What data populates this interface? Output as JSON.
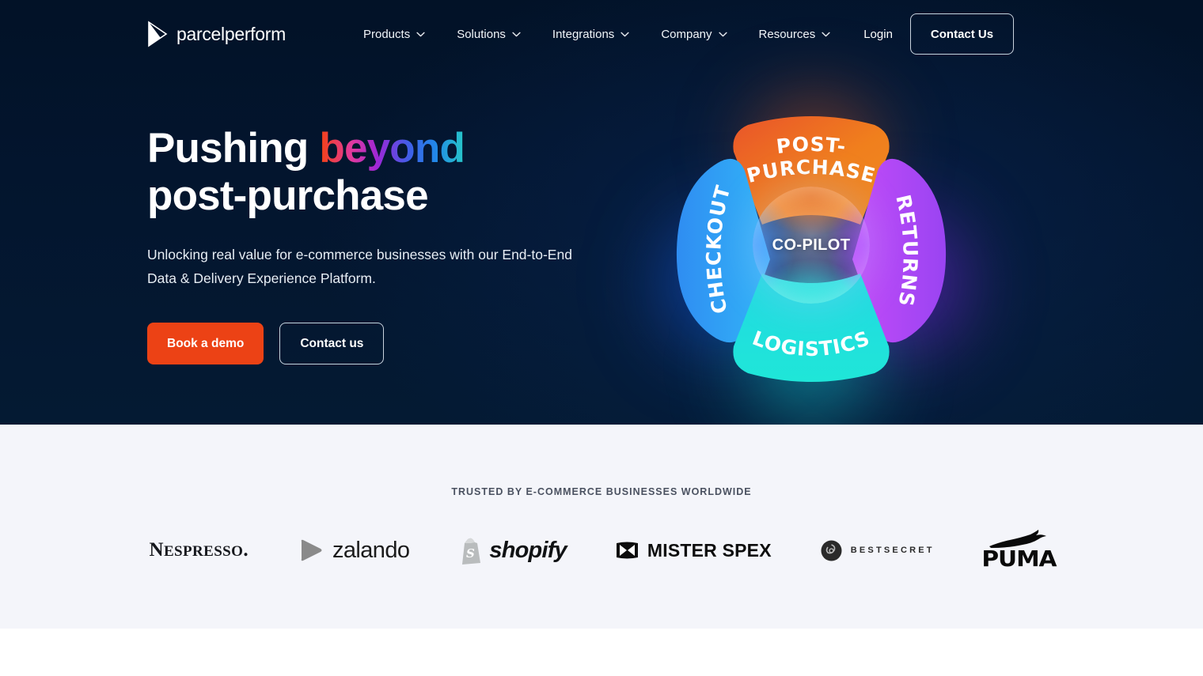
{
  "brand": {
    "logo_text": "parcelperform",
    "logo_icon": "triangle-play-mark",
    "accent_orange": "#ec4215",
    "hero_bg": "#03152e",
    "band_bg": "#f4f5fa"
  },
  "nav": {
    "items": [
      {
        "label": "Products",
        "has_chevron": true
      },
      {
        "label": "Solutions",
        "has_chevron": true
      },
      {
        "label": "Integrations",
        "has_chevron": true
      },
      {
        "label": "Company",
        "has_chevron": true
      },
      {
        "label": "Resources",
        "has_chevron": true
      }
    ],
    "login_label": "Login",
    "contact_label": "Contact Us"
  },
  "hero": {
    "headline_part1": "Pushing ",
    "headline_gradient_word": "beyond",
    "headline_part2": "post-purchase",
    "subcopy_line1": "Unlocking real value for e-commerce businesses with our",
    "subcopy_line2": "End-to-End Data & Delivery Experience Platform.",
    "cta_primary": "Book a demo",
    "cta_secondary": "Contact us",
    "gradient_stops": [
      "#f4410f",
      "#9d27d6",
      "#3f5fe8",
      "#27c8c8"
    ]
  },
  "graphic": {
    "center_label": "CO-PILOT",
    "petals": [
      {
        "name": "post-purchase",
        "line1": "POST-",
        "line2": "PURCHASE",
        "color": "#ee7a1f",
        "position": "top"
      },
      {
        "name": "checkout",
        "line1": "CHECKOUT",
        "line2": "",
        "color": "#2d9bf0",
        "position": "left"
      },
      {
        "name": "returns",
        "line1": "RETURNS",
        "line2": "",
        "color": "#b14cf5",
        "position": "right"
      },
      {
        "name": "logistics",
        "line1": "LOGISTICS",
        "line2": "",
        "color": "#24dede",
        "position": "bottom"
      }
    ]
  },
  "trusted": {
    "title": "TRUSTED BY E-COMMERCE BUSINESSES WORLDWIDE",
    "logos": [
      {
        "name": "nespresso",
        "text": "ESPRESSO",
        "lead": "N"
      },
      {
        "name": "zalando",
        "text": "zalando"
      },
      {
        "name": "shopify",
        "text": "shopify"
      },
      {
        "name": "mister-spex",
        "text": "MISTER SPEX"
      },
      {
        "name": "bestsecret",
        "text": "BESTSECRET"
      },
      {
        "name": "puma",
        "text": "PUMA"
      }
    ]
  }
}
